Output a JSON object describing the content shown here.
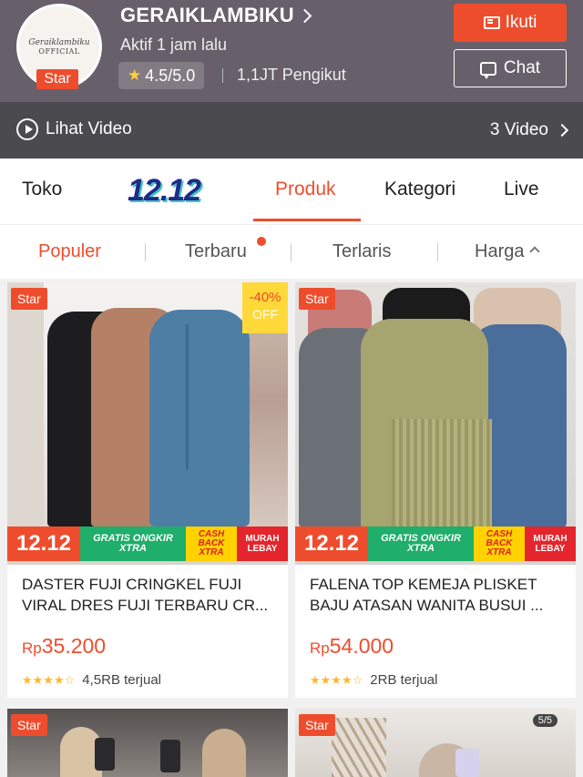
{
  "shop": {
    "avatar_line1": "Geraiklambiku",
    "avatar_line2": "OFFICIAL",
    "star_badge": "Star",
    "name": "GERAIKLAMBIKU",
    "active": "Aktif 1 jam lalu",
    "rating": "4.5/5.0",
    "followers": "1,1JT Pengikut",
    "follow_label": "Ikuti",
    "chat_label": "Chat"
  },
  "video_bar": {
    "left_label": "Lihat Video",
    "right_label": "3 Video"
  },
  "tabs": [
    {
      "label": "Toko"
    },
    {
      "label": "12.12"
    },
    {
      "label": "Produk",
      "active": true
    },
    {
      "label": "Kategori"
    },
    {
      "label": "Live"
    }
  ],
  "sort": [
    {
      "label": "Populer",
      "active": true
    },
    {
      "label": "Terbaru"
    },
    {
      "label": "Terlaris"
    },
    {
      "label": "Harga"
    }
  ],
  "promo": {
    "p1212": "12.12",
    "gratis": "GRATIS ONGKIR XTRA",
    "cashback": "CASH BACK XTRA",
    "murah": "MURAH LEBAY"
  },
  "products": [
    {
      "star": "Star",
      "discount": "-40%",
      "discount_off": "OFF",
      "title": "DASTER FUJI CRINGKEL FUJI VIRAL DRES FUJI TERBARU CR...",
      "price_prefix": "Rp",
      "price": "35.200",
      "sold": "4,5RB terjual"
    },
    {
      "star": "Star",
      "title": "FALENA TOP KEMEJA PLISKET BAJU ATASAN WANITA BUSUI ...",
      "price_prefix": "Rp",
      "price": "54.000",
      "sold": "2RB terjual"
    },
    {
      "star": "Star"
    },
    {
      "star": "Star",
      "page_badge": "5/5"
    }
  ],
  "colors": {
    "accent": "#ee4d2d",
    "header_bg": "#675f69",
    "video_bar_bg": "#4b4a4f"
  }
}
